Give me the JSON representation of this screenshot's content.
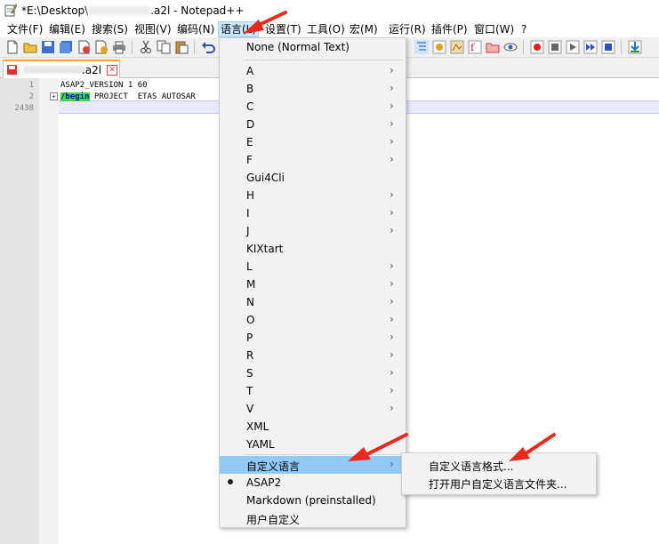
{
  "window": {
    "title_prefix": "*E:\\Desktop\\",
    "title_suffix": ".a2l - Notepad++",
    "app_icon": "notepad-icon"
  },
  "menubar": [
    {
      "label": "文件(F)"
    },
    {
      "label": "编辑(E)"
    },
    {
      "label": "搜索(S)"
    },
    {
      "label": "视图(V)"
    },
    {
      "label": "编码(N)"
    },
    {
      "label": "语言(L)"
    },
    {
      "label": "设置(T)"
    },
    {
      "label": "工具(O)"
    },
    {
      "label": "宏(M)"
    },
    {
      "label": "运行(R)"
    },
    {
      "label": "插件(P)"
    },
    {
      "label": "窗口(W)"
    },
    {
      "label": "?"
    }
  ],
  "tab": {
    "name": ".a2l",
    "close": "✕"
  },
  "editor": {
    "line_numbers": [
      "1",
      "2",
      "2438"
    ],
    "line1": "ASAP2_VERSION 1 60",
    "line2_keyword": "/begin",
    "line2_rest": " PROJECT  ETAS AUTOSAR"
  },
  "language_menu": {
    "items": [
      {
        "label": "None (Normal Text)",
        "submenu": false
      },
      {
        "label": "A",
        "submenu": true
      },
      {
        "label": "B",
        "submenu": true
      },
      {
        "label": "C",
        "submenu": true
      },
      {
        "label": "D",
        "submenu": true
      },
      {
        "label": "E",
        "submenu": true
      },
      {
        "label": "F",
        "submenu": true
      },
      {
        "label": "Gui4Cli",
        "submenu": false
      },
      {
        "label": "H",
        "submenu": true
      },
      {
        "label": "I",
        "submenu": true
      },
      {
        "label": "J",
        "submenu": true
      },
      {
        "label": "KIXtart",
        "submenu": false
      },
      {
        "label": "L",
        "submenu": true
      },
      {
        "label": "M",
        "submenu": true
      },
      {
        "label": "N",
        "submenu": true
      },
      {
        "label": "O",
        "submenu": true
      },
      {
        "label": "P",
        "submenu": true
      },
      {
        "label": "R",
        "submenu": true
      },
      {
        "label": "S",
        "submenu": true
      },
      {
        "label": "T",
        "submenu": true
      },
      {
        "label": "V",
        "submenu": true
      },
      {
        "label": "XML",
        "submenu": false
      },
      {
        "label": "YAML",
        "submenu": false
      },
      {
        "label": "自定义语言",
        "submenu": true,
        "highlighted": true
      },
      {
        "label": "ASAP2",
        "submenu": false,
        "checked": true
      },
      {
        "label": "Markdown (preinstalled)",
        "submenu": false
      },
      {
        "label": "用户自定义",
        "submenu": false
      }
    ],
    "arrow_glyph": "›"
  },
  "custom_language_submenu": {
    "items": [
      {
        "label": "自定义语言格式..."
      },
      {
        "label": "打开用户自定义语言文件夹..."
      }
    ]
  },
  "colors": {
    "menu_highlight": "#91c9f7",
    "annotation_arrow": "#e8291c",
    "keyword_bg": "#3fdc3f"
  }
}
